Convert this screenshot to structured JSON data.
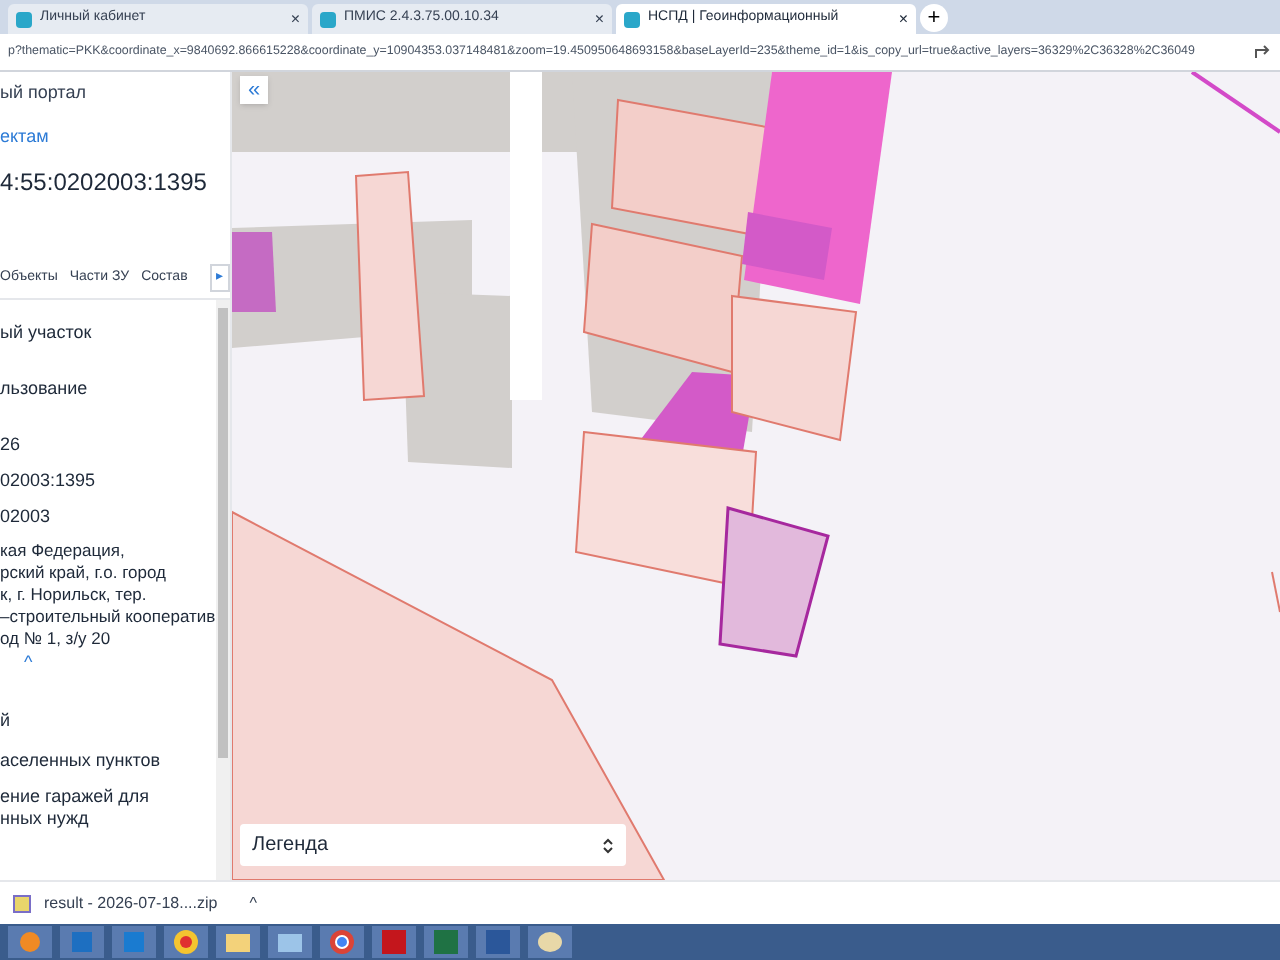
{
  "browser_tabs": [
    {
      "title": "Личный кабинет",
      "selected": false,
      "close": "×"
    },
    {
      "title": "ПМИС 2.4.3.75.00.10.34",
      "selected": false,
      "close": "×"
    },
    {
      "title": "НСПД | Геоинформационный",
      "selected": true,
      "close": "×"
    }
  ],
  "new_tab": "+",
  "address": "p?thematic=PKK&coordinate_x=9840692.866615228&coordinate_y=10904353.037148481&zoom=19.450950648693158&baseLayerId=235&theme_id=1&is_copy_url=true&active_layers=36329%2C36328%2C36049",
  "panel": {
    "portal": "ый портал",
    "link": "ектам",
    "cadastral": "4:55:0202003:1395",
    "tabs": [
      {
        "label": "Объекты",
        "selected": false
      },
      {
        "label": "Части ЗУ",
        "selected": false
      },
      {
        "label": "Состав",
        "selected": false
      }
    ],
    "tabs_more": "▸",
    "lines": [
      "ый участок",
      "льзование",
      "26",
      "02003:1395",
      "02003"
    ],
    "address_lines": [
      "кая Федерация,",
      "рский край, г.о. город",
      "к, г. Норильск, тер.",
      "–строительный кооператив",
      "од № 1, з/у 20"
    ],
    "collapse": "^",
    "extra_lines": [
      "й",
      "аселенных пунктов",
      "ение гаражей для",
      "нных нужд"
    ]
  },
  "map": {
    "collapse_button": "«",
    "legend": "Легенда"
  },
  "download": {
    "file": "result - 2026-07-18....zip",
    "toggle": "^"
  }
}
